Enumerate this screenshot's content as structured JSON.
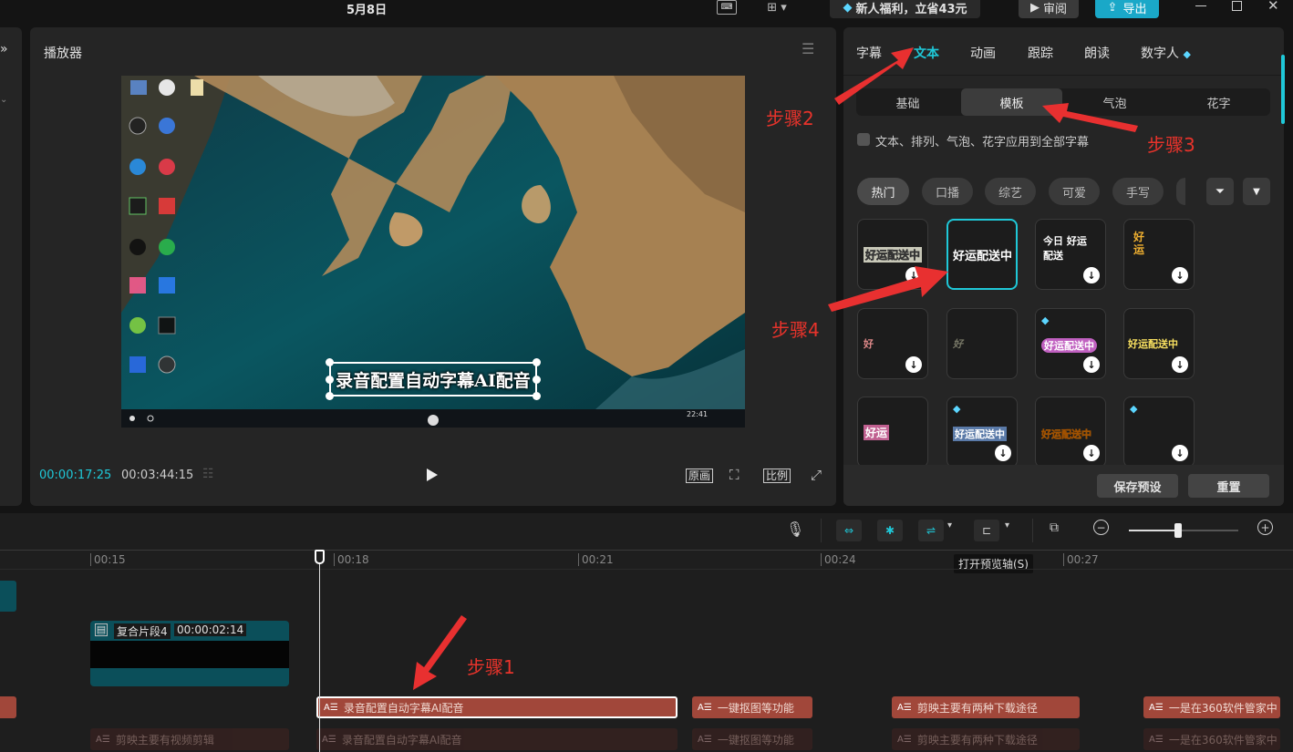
{
  "topbar": {
    "date": "5月8日",
    "promo": "新人福利，立省43元",
    "review": "审阅",
    "export": "导出"
  },
  "player": {
    "title": "播放器",
    "current_time": "00:00:17:25",
    "total_time": "00:03:44:15",
    "btn_original": "原画",
    "btn_ratio": "比例",
    "subtitle_text": "录音配置自动字幕AI配音"
  },
  "right_panel": {
    "tabs": [
      "字幕",
      "文本",
      "动画",
      "跟踪",
      "朗读",
      "数字人"
    ],
    "active_tab": "文本",
    "segments": [
      "基础",
      "模板",
      "气泡",
      "花字"
    ],
    "active_segment": "模板",
    "apply_all": "文本、排列、气泡、花字应用到全部字幕",
    "chips": [
      "热门",
      "口播",
      "综艺",
      "可爱",
      "手写"
    ],
    "cards": [
      {
        "text": "好运配送中"
      },
      {
        "text": "好运配送中"
      },
      {
        "text": "今日 好运 配送"
      },
      {
        "text": "好 运"
      },
      {
        "text": "好"
      },
      {
        "text": "好"
      },
      {
        "text": "好运配送中"
      },
      {
        "text": "好运配送中"
      },
      {
        "text": "好运"
      },
      {
        "text": "好运配送中"
      },
      {
        "text": "好运配送中"
      },
      {
        "text": ""
      }
    ],
    "save_preset": "保存预设",
    "reset": "重置"
  },
  "timeline": {
    "ticks": [
      "00:15",
      "00:18",
      "00:21",
      "00:24",
      "00:27"
    ],
    "tooltip": "打开预览轴(S)",
    "compound_clip": {
      "name": "复合片段4",
      "duration": "00:00:02:14"
    },
    "text_clips": [
      "录音配置自动字幕AI配音",
      "一键抠图等功能",
      "剪映主要有两种下载途径",
      "一是在360软件管家中"
    ],
    "ghost_clips": [
      "剪映主要有视频剪辑",
      "录音配置自动字幕AI配音",
      "一键抠图等功能",
      "剪映主要有两种下载途径",
      "一是在360软件管家中"
    ]
  },
  "annotations": {
    "step1": "步骤1",
    "step2": "步骤2",
    "step3": "步骤3",
    "step4": "步骤4"
  },
  "colors": {
    "accent": "#1fc8d8",
    "export_btn": "#1aa8c8",
    "text_clip": "#a1473a",
    "annotation": "#e8332b"
  }
}
